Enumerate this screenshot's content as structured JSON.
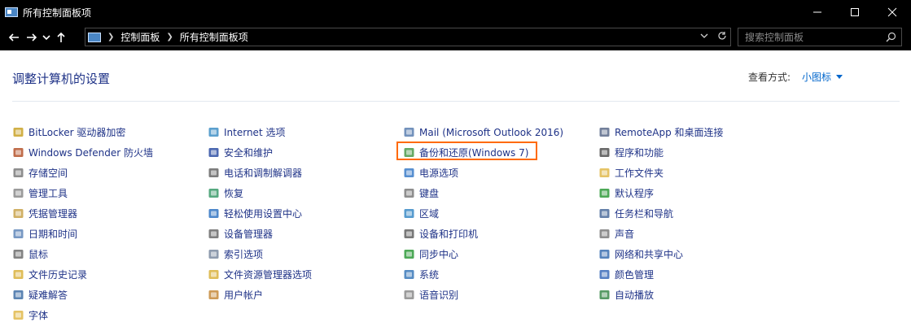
{
  "window": {
    "title": "所有控制面板项"
  },
  "nav": {
    "breadcrumbs": [
      "控制面板",
      "所有控制面板项"
    ],
    "search_placeholder": "搜索控制面板"
  },
  "content": {
    "heading": "调整计算机的设置",
    "view_by_label": "查看方式:",
    "view_by_value": "小图标"
  },
  "highlight_color": "#ff6a00",
  "columns": [
    [
      {
        "label": "BitLocker 驱动器加密",
        "icon": "bitlocker-key-icon"
      },
      {
        "label": "Windows Defender 防火墙",
        "icon": "firewall-icon"
      },
      {
        "label": "存储空间",
        "icon": "storage-spaces-icon"
      },
      {
        "label": "管理工具",
        "icon": "admin-tools-icon"
      },
      {
        "label": "凭据管理器",
        "icon": "credential-manager-icon"
      },
      {
        "label": "日期和时间",
        "icon": "date-time-icon"
      },
      {
        "label": "鼠标",
        "icon": "mouse-icon"
      },
      {
        "label": "文件历史记录",
        "icon": "file-history-icon"
      },
      {
        "label": "疑难解答",
        "icon": "troubleshooting-icon"
      },
      {
        "label": "字体",
        "icon": "fonts-icon"
      }
    ],
    [
      {
        "label": "Internet 选项",
        "icon": "internet-options-icon"
      },
      {
        "label": "安全和维护",
        "icon": "security-flag-icon"
      },
      {
        "label": "电话和调制解调器",
        "icon": "phone-modem-icon"
      },
      {
        "label": "恢复",
        "icon": "recovery-icon"
      },
      {
        "label": "轻松使用设置中心",
        "icon": "ease-of-access-icon"
      },
      {
        "label": "设备管理器",
        "icon": "device-manager-icon"
      },
      {
        "label": "索引选项",
        "icon": "indexing-icon"
      },
      {
        "label": "文件资源管理器选项",
        "icon": "explorer-options-icon"
      },
      {
        "label": "用户帐户",
        "icon": "user-accounts-icon"
      }
    ],
    [
      {
        "label": "Mail (Microsoft Outlook 2016)",
        "icon": "mail-icon"
      },
      {
        "label": "备份和还原(Windows 7)",
        "icon": "backup-restore-icon"
      },
      {
        "label": "电源选项",
        "icon": "power-options-icon"
      },
      {
        "label": "键盘",
        "icon": "keyboard-icon"
      },
      {
        "label": "区域",
        "icon": "region-globe-icon"
      },
      {
        "label": "设备和打印机",
        "icon": "devices-printers-icon"
      },
      {
        "label": "同步中心",
        "icon": "sync-center-icon"
      },
      {
        "label": "系统",
        "icon": "system-icon"
      },
      {
        "label": "语音识别",
        "icon": "speech-microphone-icon"
      }
    ],
    [
      {
        "label": "RemoteApp 和桌面连接",
        "icon": "remoteapp-icon"
      },
      {
        "label": "程序和功能",
        "icon": "programs-features-icon"
      },
      {
        "label": "工作文件夹",
        "icon": "work-folders-icon"
      },
      {
        "label": "默认程序",
        "icon": "default-programs-icon"
      },
      {
        "label": "任务栏和导航",
        "icon": "taskbar-icon"
      },
      {
        "label": "声音",
        "icon": "sound-speaker-icon"
      },
      {
        "label": "网络和共享中心",
        "icon": "network-sharing-icon"
      },
      {
        "label": "颜色管理",
        "icon": "color-management-icon"
      },
      {
        "label": "自动播放",
        "icon": "autoplay-icon"
      }
    ]
  ]
}
